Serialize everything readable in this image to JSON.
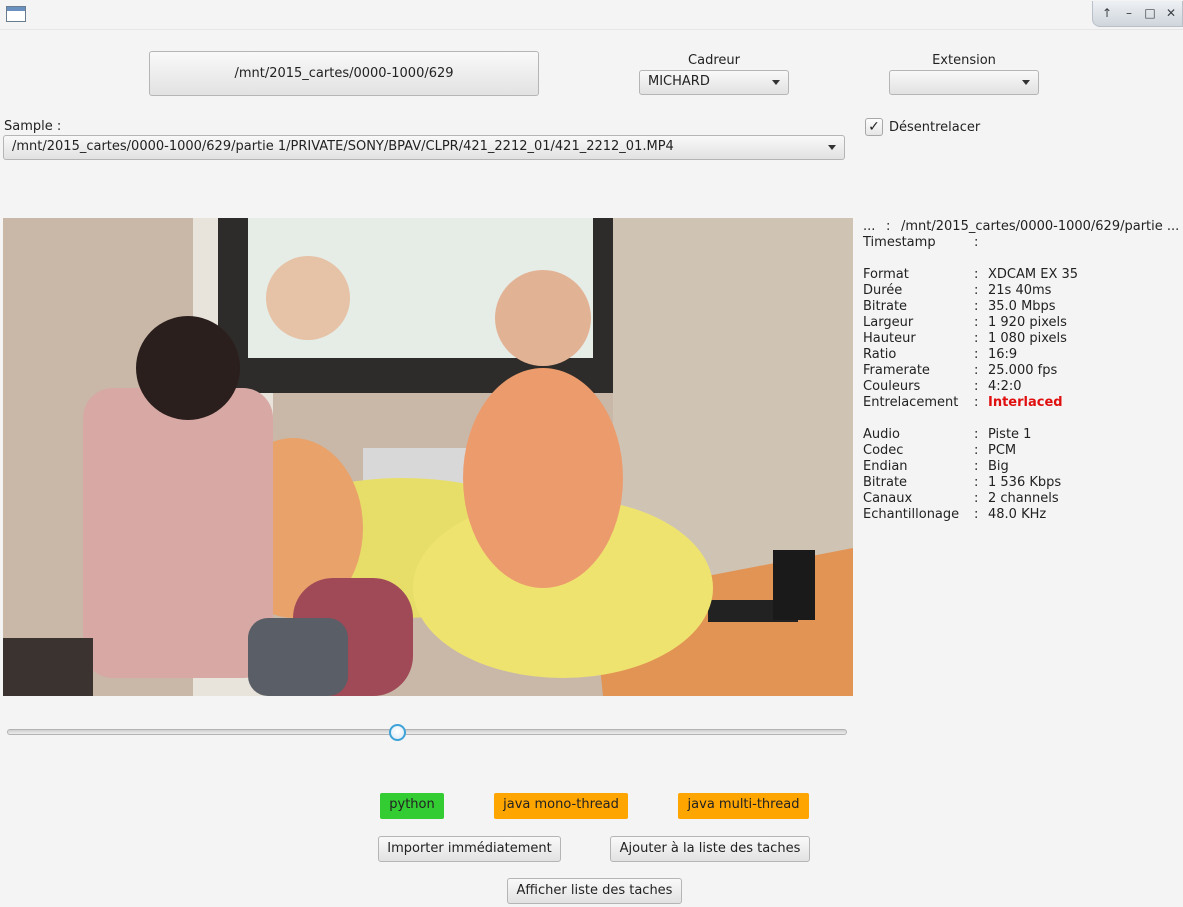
{
  "top": {
    "folder_button": "/mnt/2015_cartes/0000-1000/629",
    "cadreur_label": "Cadreur",
    "cadreur_value": "MICHARD",
    "extension_label": "Extension",
    "extension_value": ""
  },
  "sample": {
    "label": "Sample :",
    "value": "/mnt/2015_cartes/0000-1000/629/partie 1/PRIVATE/SONY/BPAV/CLPR/421_2212_01/421_2212_01.MP4"
  },
  "deinterlace": {
    "label": "Désentrelacer",
    "checked": true
  },
  "info": {
    "header_key": "...",
    "header_value": "/mnt/2015_cartes/0000-1000/629/partie ...",
    "timestamp_key": "Timestamp",
    "timestamp_value": "",
    "video": [
      {
        "k": "Format",
        "v": "XDCAM EX 35"
      },
      {
        "k": "Durée",
        "v": "21s 40ms"
      },
      {
        "k": "Bitrate",
        "v": "35.0 Mbps"
      },
      {
        "k": "Largeur",
        "v": "1 920 pixels"
      },
      {
        "k": "Hauteur",
        "v": "1 080 pixels"
      },
      {
        "k": "Ratio",
        "v": "16:9"
      },
      {
        "k": "Framerate",
        "v": "25.000 fps"
      },
      {
        "k": "Couleurs",
        "v": "4:2:0"
      },
      {
        "k": "Entrelacement",
        "v": "Interlaced"
      }
    ],
    "audio": [
      {
        "k": "Audio",
        "v": "Piste 1"
      },
      {
        "k": "Codec",
        "v": "PCM"
      },
      {
        "k": "Endian",
        "v": "Big"
      },
      {
        "k": "Bitrate",
        "v": "1 536 Kbps"
      },
      {
        "k": "Canaux",
        "v": "2 channels"
      },
      {
        "k": "Echantillonage",
        "v": "48.0 KHz"
      }
    ],
    "separator": ":"
  },
  "slider": {
    "position_fraction": 0.465
  },
  "modes": {
    "python": "python",
    "java_mono": "java mono-thread",
    "java_multi": "java multi-thread"
  },
  "actions": {
    "import_now": "Importer immédiatement",
    "add_to_tasks": "Ajouter à la liste des taches",
    "show_tasks": "Afficher liste des taches"
  },
  "colors": {
    "python_bg": "#33cc33",
    "java_bg": "#ffa500",
    "interlaced": "#e01010",
    "slider_accent": "#3da3d8"
  }
}
